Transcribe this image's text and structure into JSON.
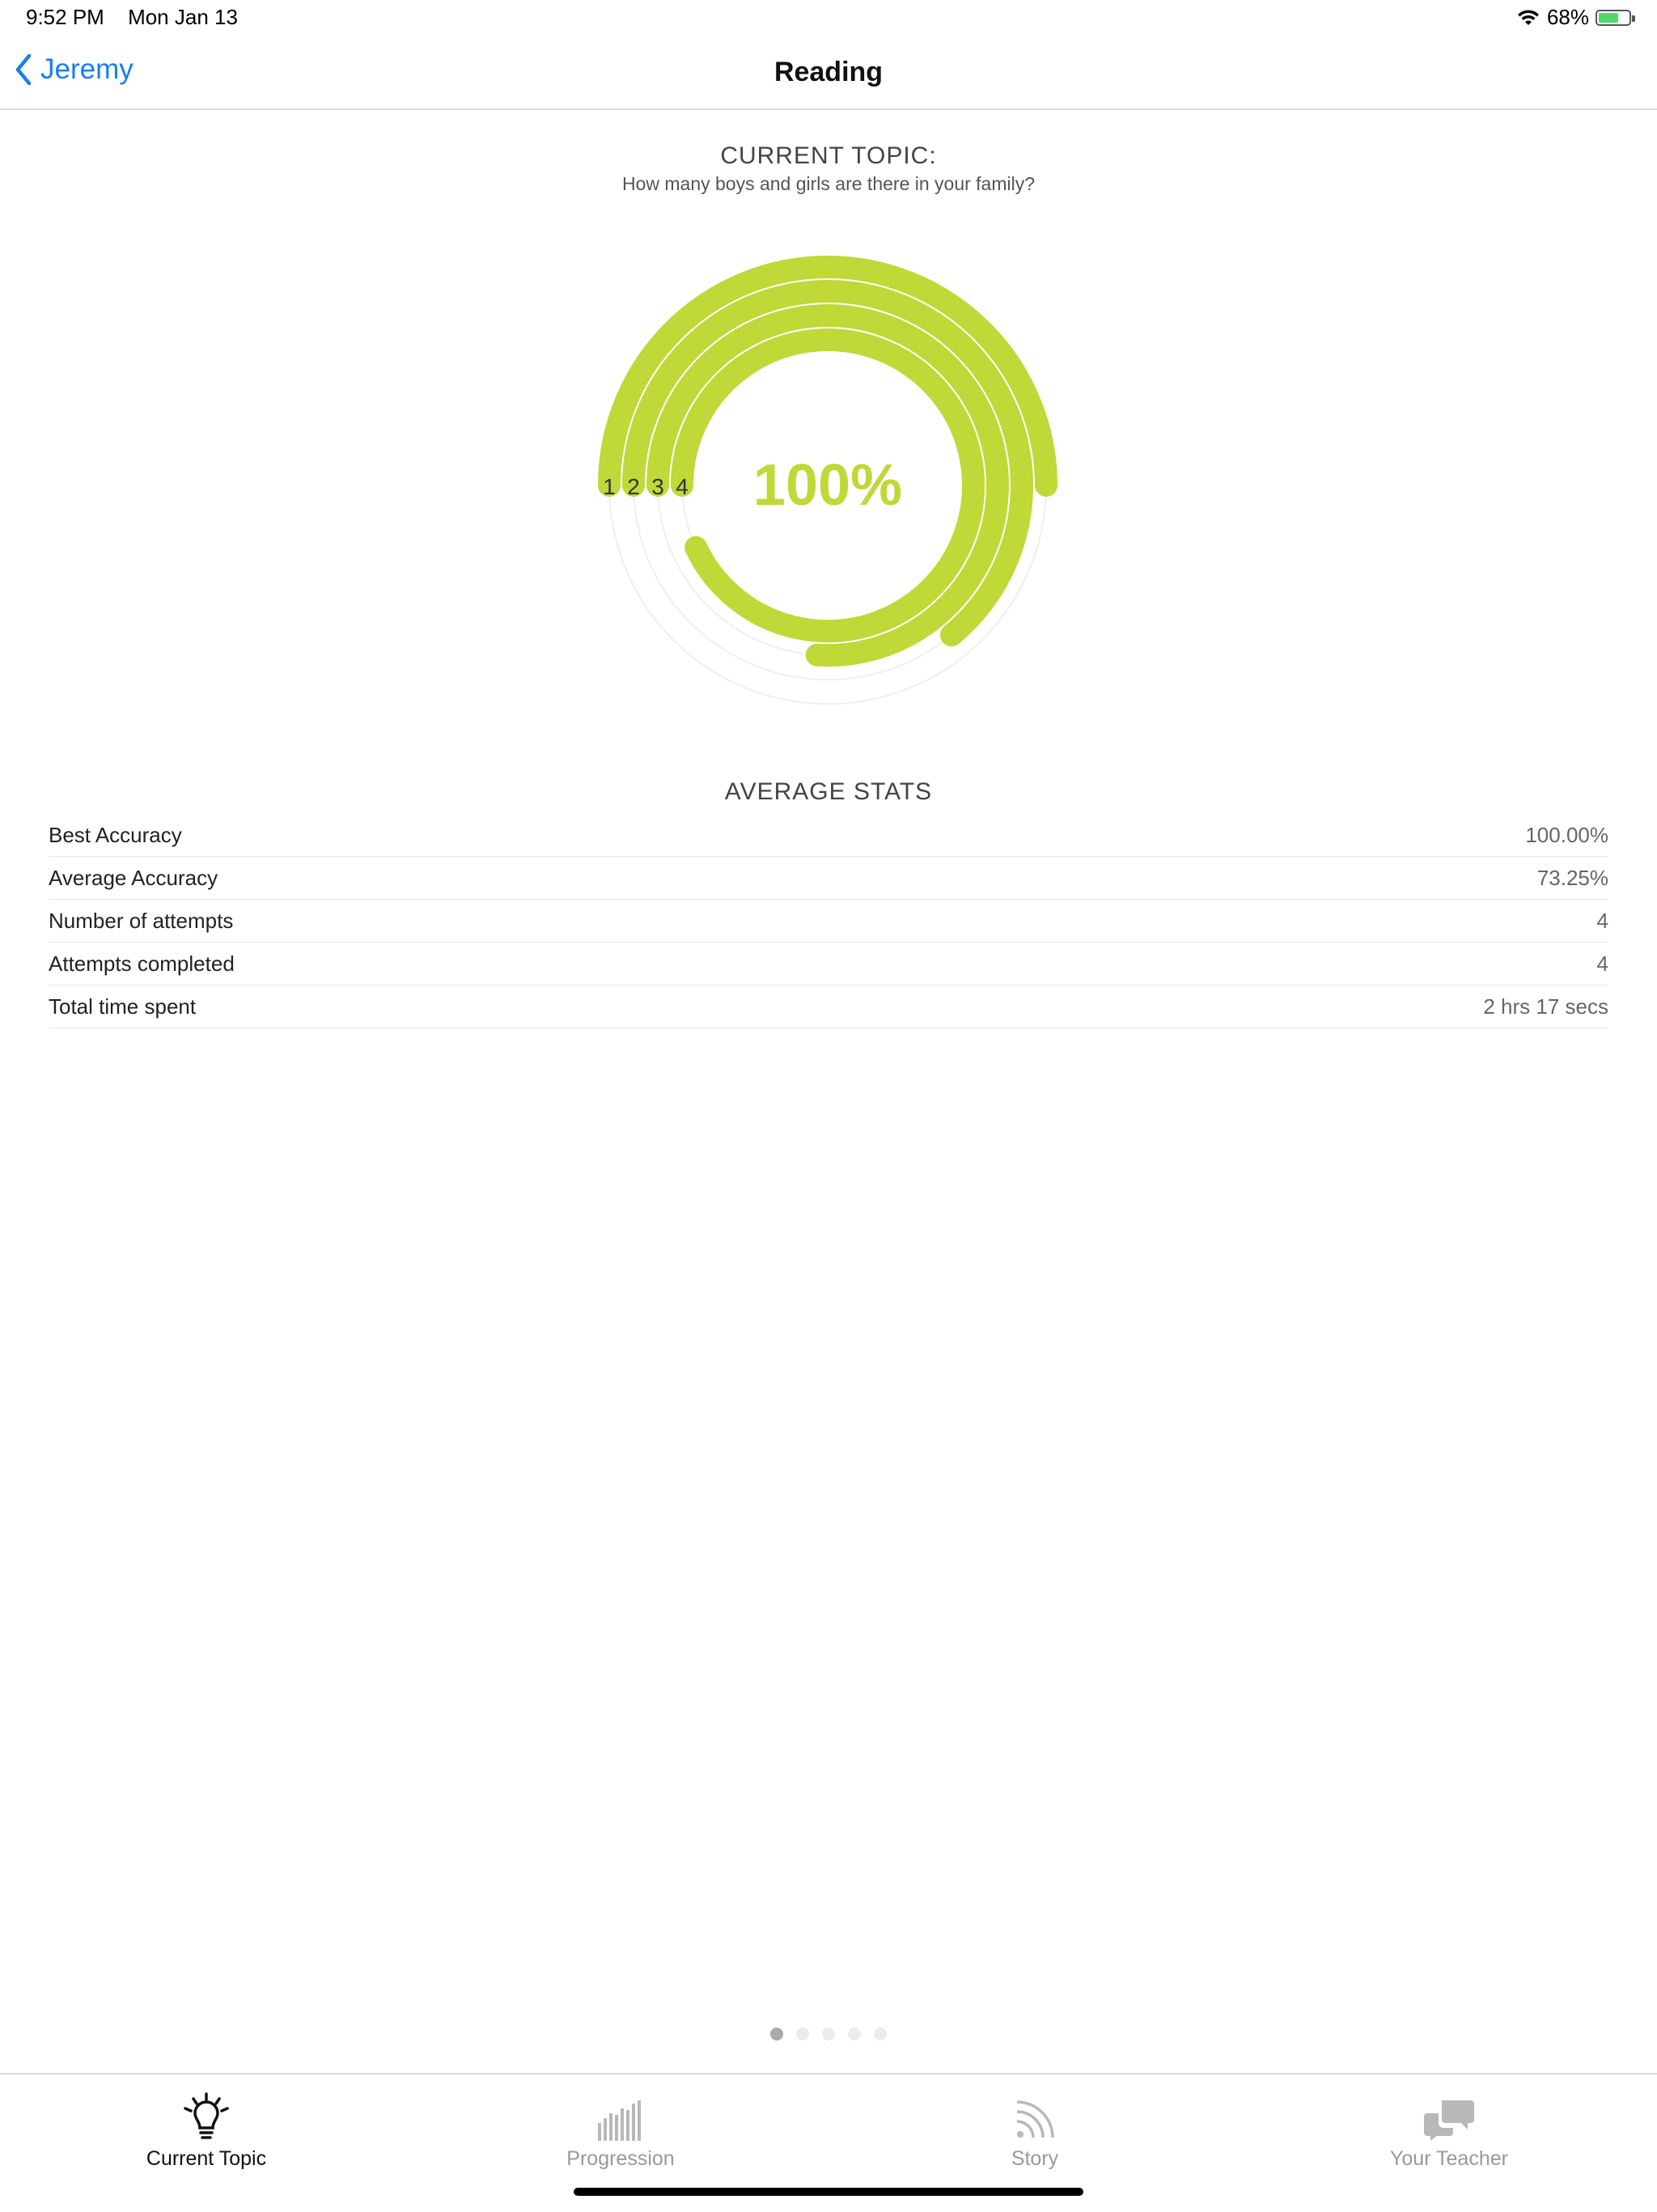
{
  "status_bar": {
    "time": "9:52 PM",
    "date": "Mon Jan 13",
    "battery_percent": "68%",
    "battery_level": 0.68
  },
  "nav": {
    "back_label": "Jeremy",
    "title": "Reading"
  },
  "topic": {
    "label": "CURRENT TOPIC:",
    "text": "How many boys and girls are there in your family?"
  },
  "chart_data": {
    "type": "radial-bar",
    "center_label": "100%",
    "ring_labels": [
      "1",
      "2",
      "3",
      "4"
    ],
    "values": [
      0.5,
      0.64,
      0.76,
      0.93
    ],
    "color": "#c0d838"
  },
  "stats": {
    "title": "AVERAGE STATS",
    "rows": [
      {
        "label": "Best Accuracy",
        "value": "100.00%"
      },
      {
        "label": "Average Accuracy",
        "value": "73.25%"
      },
      {
        "label": "Number of attempts",
        "value": "4"
      },
      {
        "label": "Attempts completed",
        "value": "4"
      },
      {
        "label": "Total time spent",
        "value": "2 hrs 17 secs"
      }
    ]
  },
  "page_indicator": {
    "count": 5,
    "active": 1
  },
  "tabs": [
    {
      "label": "Current Topic",
      "icon": "lightbulb-icon",
      "active": true
    },
    {
      "label": "Progression",
      "icon": "bars-icon",
      "active": false
    },
    {
      "label": "Story",
      "icon": "rss-icon",
      "active": false
    },
    {
      "label": "Your Teacher",
      "icon": "chat-bubbles-icon",
      "active": false
    }
  ],
  "colors": {
    "accent": "#c0d838",
    "link": "#1a7df0",
    "inactive_tab": "#999999"
  }
}
